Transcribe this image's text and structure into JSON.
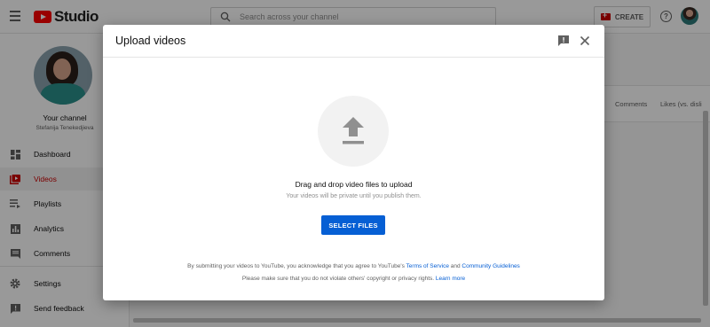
{
  "app": {
    "logo_text": "Studio",
    "search_placeholder": "Search across your channel",
    "create_label": "CREATE",
    "help_symbol": "?"
  },
  "sidebar": {
    "channel_title": "Your channel",
    "channel_name": "Stefanija Tenekedjieva",
    "items": [
      {
        "label": "Dashboard",
        "icon": "dashboard-icon"
      },
      {
        "label": "Videos",
        "icon": "videos-icon",
        "active": true
      },
      {
        "label": "Playlists",
        "icon": "playlists-icon"
      },
      {
        "label": "Analytics",
        "icon": "analytics-icon"
      },
      {
        "label": "Comments",
        "icon": "comments-icon"
      },
      {
        "label": "Settings",
        "icon": "settings-icon"
      },
      {
        "label": "Send feedback",
        "icon": "feedback-icon"
      }
    ]
  },
  "table": {
    "columns": [
      "Comments",
      "Likes (vs. disli"
    ]
  },
  "dialog": {
    "title": "Upload videos",
    "drag_text": "Drag and drop video files to upload",
    "private_text": "Your videos will be private until you publish them.",
    "select_button": "SELECT FILES",
    "terms_prefix": "By submitting your videos to YouTube, you acknowledge that you agree to YouTube's ",
    "terms_link": "Terms of Service",
    "terms_and": " and ",
    "guidelines_link": "Community Guidelines",
    "policy_text": "Please make sure that you do not violate others' copyright or privacy rights. ",
    "learn_more_link": "Learn more"
  },
  "colors": {
    "accent": "#065fd4",
    "brand_red": "#ff0000",
    "active_red": "#cc0000"
  }
}
